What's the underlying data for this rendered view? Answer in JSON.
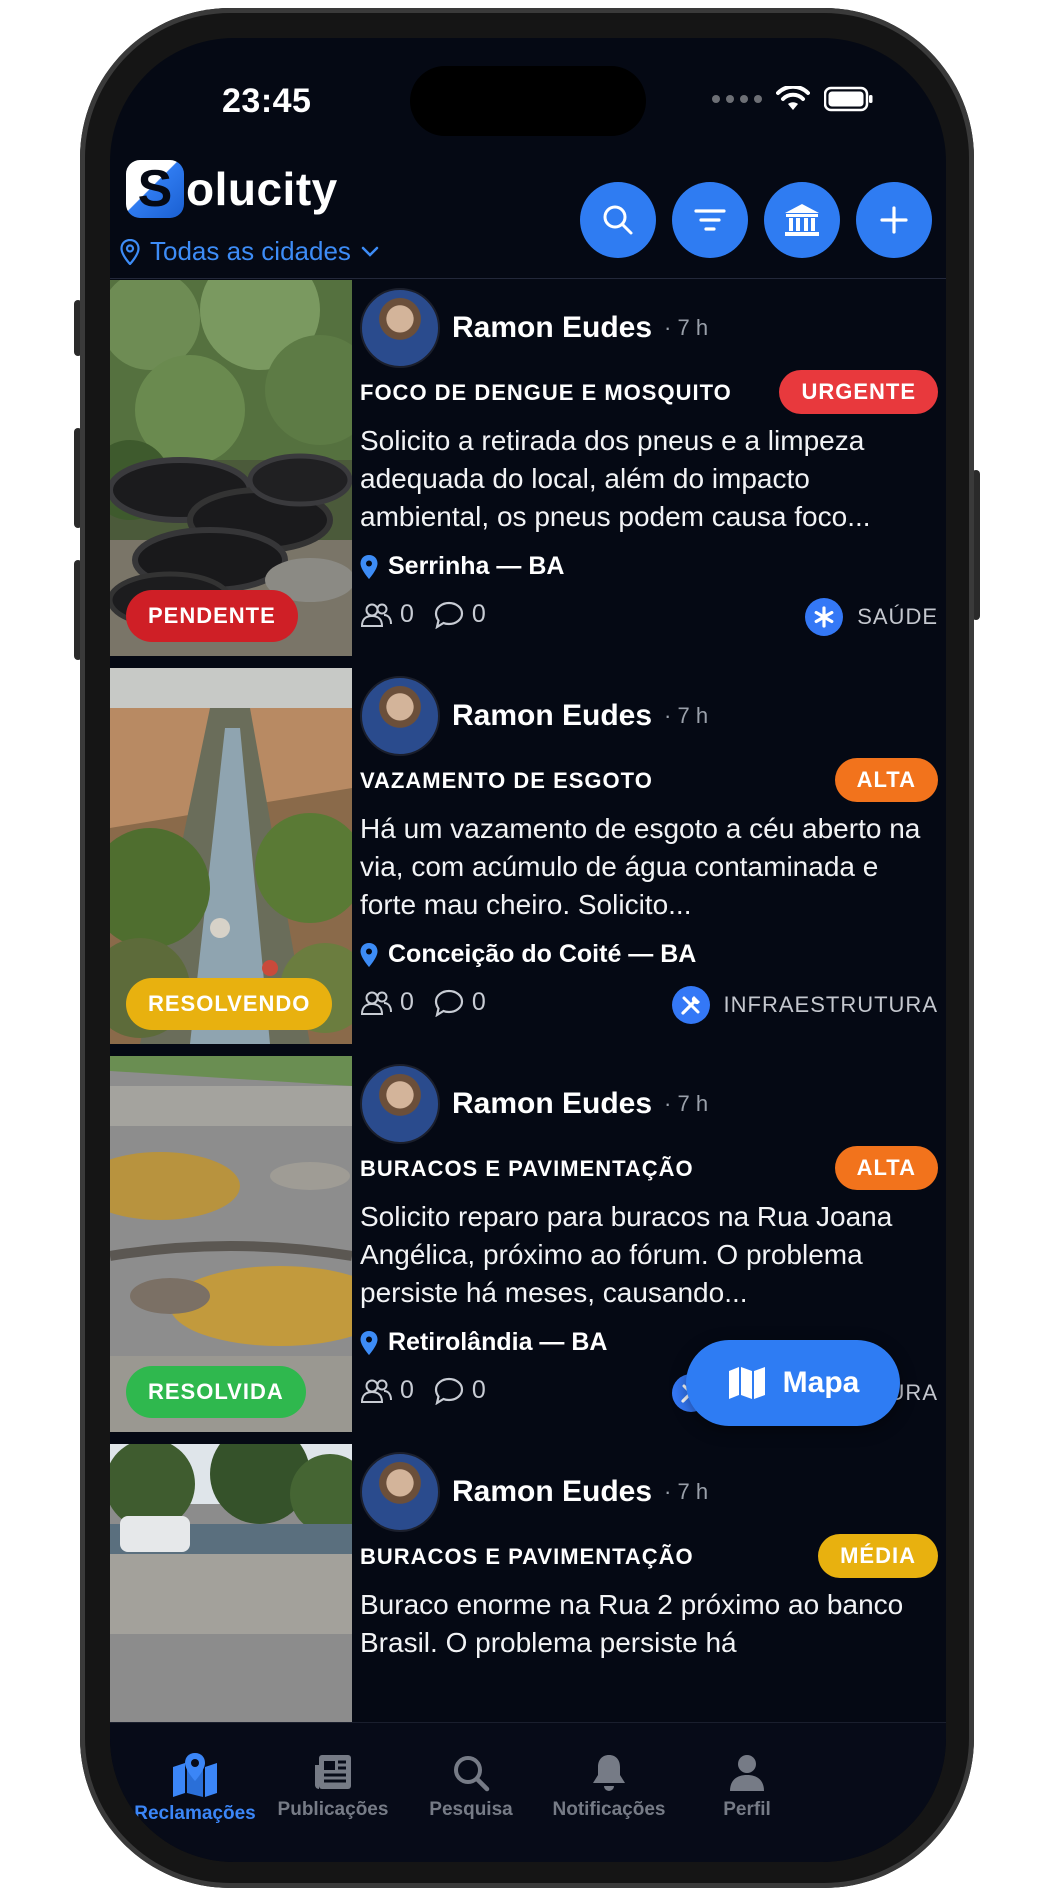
{
  "status_bar": {
    "time": "23:45"
  },
  "app": {
    "name": "Solucity",
    "logo_letter": "S",
    "logo_rest": "olucity",
    "city_filter": "Todas as cidades"
  },
  "header_actions": [
    {
      "icon": "search-icon"
    },
    {
      "icon": "filter-icon"
    },
    {
      "icon": "institution-icon"
    },
    {
      "icon": "plus-icon"
    }
  ],
  "posts": [
    {
      "author": "Ramon Eudes",
      "time_ago": "· 7 h",
      "category": "FOCO DE DENGUE E MOSQUITO",
      "priority": "URGENTE",
      "priority_color": "#e8393d",
      "description": "Solicito a retirada dos pneus e a limpeza adequada do local, além do impacto ambiental, os pneus podem causa foco...",
      "location": "Serrinha — BA",
      "supporters": "0",
      "comments": "0",
      "domain": "SAÚDE",
      "domain_icon": "asterisk-icon",
      "status": "PENDENTE",
      "status_color": "#cf1f26",
      "image": "tires"
    },
    {
      "author": "Ramon Eudes",
      "time_ago": "· 7 h",
      "category": "VAZAMENTO DE ESGOTO",
      "priority": "ALTA",
      "priority_color": "#f2731c",
      "description": "Há um vazamento de esgoto a céu aberto na via, com acúmulo de água contaminada e forte mau cheiro. Solicito...",
      "location": "Conceição do Coité — BA",
      "supporters": "0",
      "comments": "0",
      "domain": "INFRAESTRUTURA",
      "domain_icon": "tools-icon",
      "status": "RESOLVENDO",
      "status_color": "#e8b10f",
      "image": "sewage"
    },
    {
      "author": "Ramon Eudes",
      "time_ago": "· 7 h",
      "category": "BURACOS E PAVIMENTAÇÃO",
      "priority": "ALTA",
      "priority_color": "#f2731c",
      "description": "Solicito reparo para buracos na Rua Joana Angélica, próximo ao fórum. O problema persiste há meses, causando...",
      "location": "Retirolândia — BA",
      "supporters": "0",
      "comments": "0",
      "domain": "INFRAESTRUTURA",
      "domain_icon": "tools-icon",
      "status": "RESOLVIDA",
      "status_color": "#2fb84e",
      "image": "pothole"
    },
    {
      "author": "Ramon Eudes",
      "time_ago": "· 7 h",
      "category": "BURACOS E PAVIMENTAÇÃO",
      "priority": "MÉDIA",
      "priority_color": "#e8b10f",
      "description": "Buraco enorme na Rua 2 próximo ao banco Brasil. O problema persiste há",
      "image": "street"
    }
  ],
  "fab": {
    "label": "Mapa",
    "icon": "map-icon"
  },
  "tabs": [
    {
      "label": "Reclamações",
      "icon": "map-pin-icon",
      "active": true
    },
    {
      "label": "Publicações",
      "icon": "newspaper-icon",
      "active": false
    },
    {
      "label": "Pesquisa",
      "icon": "search-icon",
      "active": false
    },
    {
      "label": "Notificações",
      "icon": "bell-icon",
      "active": false
    },
    {
      "label": "Perfil",
      "icon": "user-icon",
      "active": false
    }
  ],
  "colors": {
    "background": "#050914",
    "accent": "#2f7cf2",
    "link": "#3d8cf6"
  }
}
